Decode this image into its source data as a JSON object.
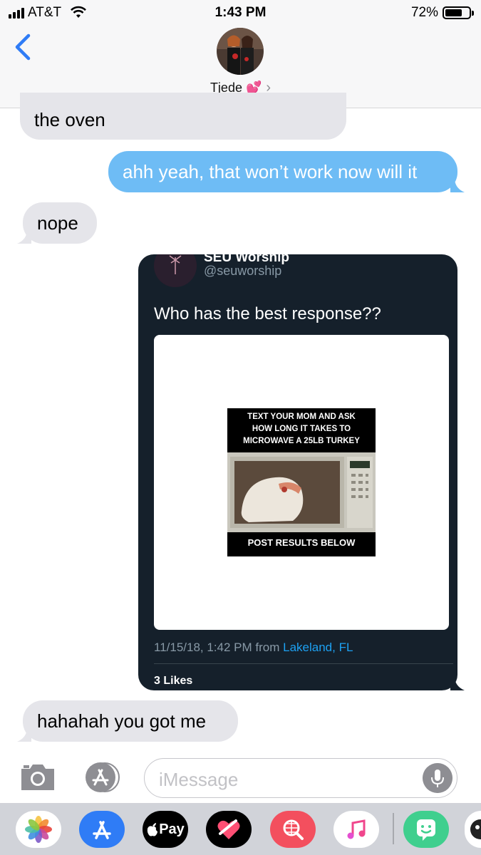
{
  "status_bar": {
    "carrier": "AT&T",
    "time": "1:43 PM",
    "battery_percent": "72%",
    "battery_level": 0.72
  },
  "nav": {
    "contact_name": "Tjede 💕",
    "chevron": "›"
  },
  "messages": [
    {
      "direction": "incoming",
      "text": "the oven"
    },
    {
      "direction": "outgoing",
      "text": "ahh yeah, that won’t work now will it"
    },
    {
      "direction": "incoming",
      "text": "nope"
    },
    {
      "direction": "outgoing",
      "type": "tweet-screenshot"
    },
    {
      "direction": "incoming",
      "text": "hahahah you got me"
    }
  ],
  "tweet": {
    "name": "SEU Worship",
    "handle": "@seuworship",
    "text": "Who has the best response??",
    "meme_top": [
      "TEXT YOUR MOM AND ASK",
      "HOW LONG IT TAKES TO",
      "MICROWAVE A 25LB TURKEY"
    ],
    "meme_bottom": "POST RESULTS BELOW",
    "timestamp": "11/15/18, 1:42 PM from ",
    "location": "Lakeland, FL",
    "likes": "3 Likes"
  },
  "input": {
    "placeholder": "iMessage"
  },
  "tray": {
    "pay_label": "Pay",
    "icons": [
      "photos-icon",
      "app-store-icon",
      "apple-pay-icon",
      "heart-sticker-icon",
      "web-search-icon",
      "music-icon",
      "bitmoji-icon",
      "more-app-icon"
    ]
  },
  "colors": {
    "outgoing_bubble": "#6ebcf5",
    "incoming_bubble": "#e5e5ea",
    "tweet_bg": "#15202b",
    "link_blue": "#1da1f2",
    "ios_blue": "#2f7cf6"
  }
}
